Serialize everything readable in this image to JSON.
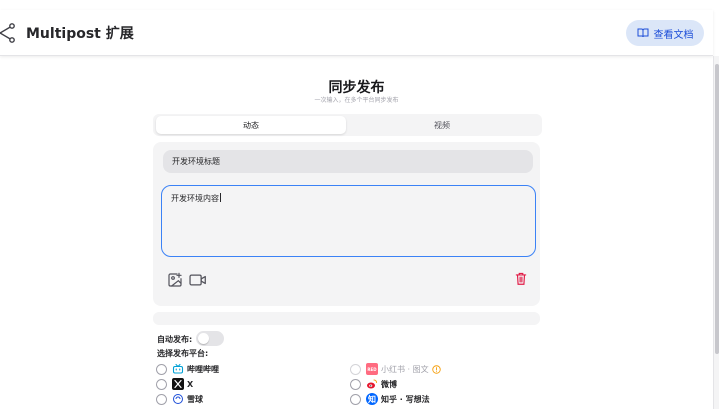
{
  "header": {
    "app_title": "Multipost 扩展",
    "docs_button": "查看文档"
  },
  "main": {
    "title": "同步发布",
    "subtitle": "一次输入，在多个平台同步发布",
    "tabs": [
      {
        "label": "动态",
        "active": true
      },
      {
        "label": "视频",
        "active": false
      }
    ],
    "title_input_value": "开发环境标题",
    "content_input_value": "开发环境内容"
  },
  "options": {
    "auto_publish_label": "自动发布:",
    "auto_publish_on": false,
    "select_platform_label": "选择发布平台:"
  },
  "platforms": [
    {
      "name": "哔哩哔哩",
      "icon": "bilibili-icon",
      "enabled": true
    },
    {
      "name": "小红书 · 图文",
      "icon": "xiaohongshu-icon",
      "enabled": false,
      "warning": true
    },
    {
      "name": "X",
      "icon": "x-icon",
      "enabled": true
    },
    {
      "name": "微博",
      "icon": "weibo-icon",
      "enabled": true
    },
    {
      "name": "雪球",
      "icon": "xueqiu-icon",
      "enabled": true
    },
    {
      "name": "知乎 · 写想法",
      "icon": "zhihu-icon",
      "enabled": true
    }
  ],
  "colors": {
    "accent": "#3b82f6",
    "docs_bg": "#dbe6f8",
    "docs_text": "#1d4ed8",
    "danger": "#e11d48",
    "bilibili": "#00a1d6",
    "xiaohongshu": "#ff2442",
    "weibo": "#e6162d",
    "zhihu": "#0066ff",
    "warning": "#f59e0b"
  }
}
